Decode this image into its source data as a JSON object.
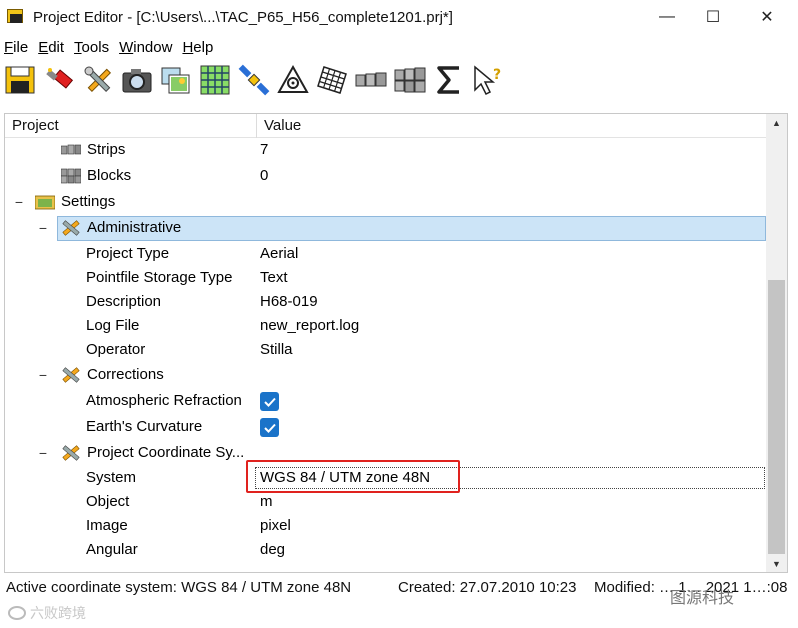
{
  "window": {
    "title": "Project Editor - [C:\\Users\\...\\TAC_P65_H56_complete1201.prj*]",
    "minimize": "—",
    "maximize": "☐",
    "close": "✕"
  },
  "menu": [
    {
      "label": "File",
      "key": "F",
      "rest": "ile"
    },
    {
      "label": "Edit",
      "key": "E",
      "rest": "dit"
    },
    {
      "label": "Tools",
      "key": "T",
      "rest": "ools"
    },
    {
      "label": "Window",
      "key": "W",
      "rest": "indow"
    },
    {
      "label": "Help",
      "key": "H",
      "rest": "elp"
    }
  ],
  "toolbar": {
    "icons": [
      "save-icon",
      "clear-icon",
      "settings-tools-icon",
      "camera-icon",
      "images-icon",
      "image-grid-icon",
      "satellite-icon",
      "control-point-icon",
      "grid-net-icon",
      "strips-icon",
      "blocks-icon",
      "sigma-icon",
      "help-pointer-icon"
    ]
  },
  "tree": {
    "header": {
      "project": "Project",
      "value": "Value"
    },
    "rows": {
      "strips": {
        "label": "Strips",
        "value": "7"
      },
      "blocks": {
        "label": "Blocks",
        "value": "0"
      },
      "settings": {
        "label": "Settings",
        "expander": "−"
      },
      "administrative": {
        "label": "Administrative",
        "expander": "−"
      },
      "project_type": {
        "label": "Project Type",
        "value": "Aerial"
      },
      "pointfile_storage": {
        "label": "Pointfile Storage Type",
        "value": "Text"
      },
      "description": {
        "label": "Description",
        "value": "H68-019"
      },
      "log_file": {
        "label": "Log File",
        "value": "new_report.log"
      },
      "operator": {
        "label": "Operator",
        "value": "Stilla"
      },
      "corrections": {
        "label": "Corrections",
        "expander": "−"
      },
      "atmospheric_refraction": {
        "label": "Atmospheric Refraction",
        "checked": true
      },
      "earth_curvature": {
        "label": "Earth's Curvature",
        "checked": true
      },
      "project_coord": {
        "label": "Project Coordinate Sy...",
        "expander": "−"
      },
      "system": {
        "label": "System",
        "value": "WGS 84 / UTM zone 48N"
      },
      "object": {
        "label": "Object",
        "value": "m"
      },
      "image": {
        "label": "Image",
        "value": "pixel"
      },
      "angular": {
        "label": "Angular",
        "value": "deg"
      }
    }
  },
  "status": {
    "active": "Active coordinate system: WGS 84 / UTM zone 48N",
    "created": "Created: 27.07.2010 10:23",
    "modified": "Modified: … 1… 2021 1…:08"
  },
  "watermarks": {
    "left": "六败跨境",
    "right": "图源科技"
  },
  "colors": {
    "selection": "#cce4f7",
    "checkbox": "#1a73c9",
    "highlight_box": "#e0221e"
  }
}
